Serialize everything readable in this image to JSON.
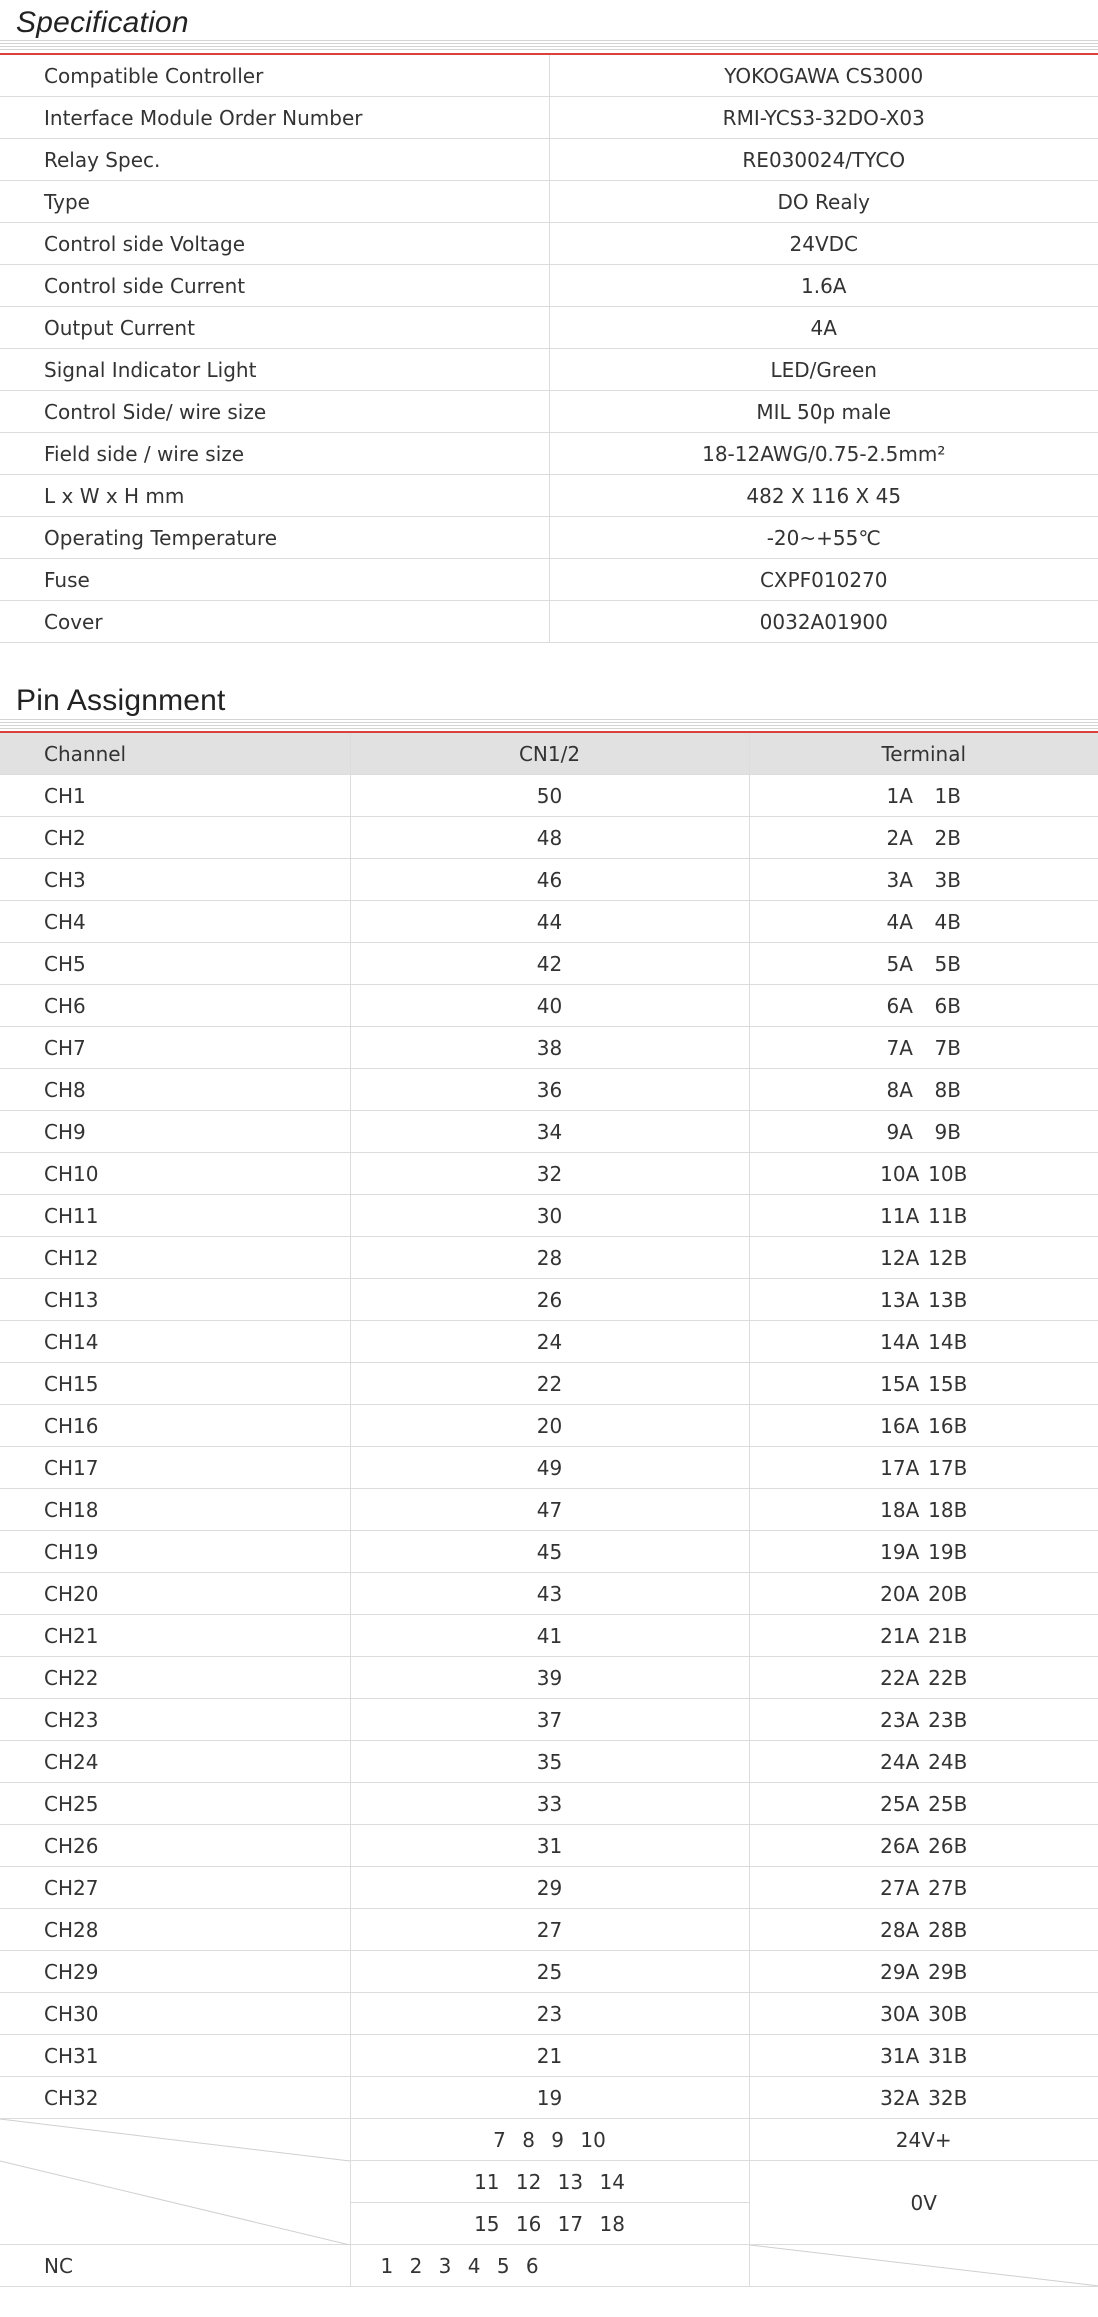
{
  "spec": {
    "title": "Specification",
    "rows": [
      {
        "label": "Compatible Controller",
        "value": "YOKOGAWA  CS3000"
      },
      {
        "label": "Interface Module Order Number",
        "value": "RMI-YCS3-32DO-X03"
      },
      {
        "label": "Relay Spec.",
        "value": "RE030024/TYCO"
      },
      {
        "label": "Type",
        "value": "DO Realy"
      },
      {
        "label": "Control side Voltage",
        "value": "24VDC"
      },
      {
        "label": "Control side Current",
        "value": "1.6A"
      },
      {
        "label": "Output Current",
        "value": "4A"
      },
      {
        "label": "Signal Indicator Light",
        "value": "LED/Green"
      },
      {
        "label": "Control Side/ wire size",
        "value": "MIL  50p  male"
      },
      {
        "label": "Field side / wire size",
        "value": "18-12AWG/0.75-2.5mm²"
      },
      {
        "label": "L x W x H mm",
        "value": "482 X 116 X 45"
      },
      {
        "label": "Operating Temperature",
        "value": "-20~+55℃"
      },
      {
        "label": "Fuse",
        "value": "CXPF010270"
      },
      {
        "label": "Cover",
        "value": "0032A01900"
      }
    ]
  },
  "pins": {
    "title": "Pin Assignment",
    "headers": [
      "Channel",
      "CN1/2",
      "Terminal"
    ],
    "rows": [
      {
        "ch": "CH1",
        "cn": "50",
        "a": "1A",
        "b": "1B"
      },
      {
        "ch": "CH2",
        "cn": "48",
        "a": "2A",
        "b": "2B"
      },
      {
        "ch": "CH3",
        "cn": "46",
        "a": "3A",
        "b": "3B"
      },
      {
        "ch": "CH4",
        "cn": "44",
        "a": "4A",
        "b": "4B"
      },
      {
        "ch": "CH5",
        "cn": "42",
        "a": "5A",
        "b": "5B"
      },
      {
        "ch": "CH6",
        "cn": "40",
        "a": "6A",
        "b": "6B"
      },
      {
        "ch": "CH7",
        "cn": "38",
        "a": "7A",
        "b": "7B"
      },
      {
        "ch": "CH8",
        "cn": "36",
        "a": "8A",
        "b": "8B"
      },
      {
        "ch": "CH9",
        "cn": "34",
        "a": "9A",
        "b": "9B"
      },
      {
        "ch": "CH10",
        "cn": "32",
        "a": "10A",
        "b": "10B"
      },
      {
        "ch": "CH11",
        "cn": "30",
        "a": "11A",
        "b": "11B"
      },
      {
        "ch": "CH12",
        "cn": "28",
        "a": "12A",
        "b": "12B"
      },
      {
        "ch": "CH13",
        "cn": "26",
        "a": "13A",
        "b": "13B"
      },
      {
        "ch": "CH14",
        "cn": "24",
        "a": "14A",
        "b": "14B"
      },
      {
        "ch": "CH15",
        "cn": "22",
        "a": "15A",
        "b": "15B"
      },
      {
        "ch": "CH16",
        "cn": "20",
        "a": "16A",
        "b": "16B"
      },
      {
        "ch": "CH17",
        "cn": "49",
        "a": "17A",
        "b": "17B"
      },
      {
        "ch": "CH18",
        "cn": "47",
        "a": "18A",
        "b": "18B"
      },
      {
        "ch": "CH19",
        "cn": "45",
        "a": "19A",
        "b": "19B"
      },
      {
        "ch": "CH20",
        "cn": "43",
        "a": "20A",
        "b": "20B"
      },
      {
        "ch": "CH21",
        "cn": "41",
        "a": "21A",
        "b": "21B"
      },
      {
        "ch": "CH22",
        "cn": "39",
        "a": "22A",
        "b": "22B"
      },
      {
        "ch": "CH23",
        "cn": "37",
        "a": "23A",
        "b": "23B"
      },
      {
        "ch": "CH24",
        "cn": "35",
        "a": "24A",
        "b": "24B"
      },
      {
        "ch": "CH25",
        "cn": "33",
        "a": "25A",
        "b": "25B"
      },
      {
        "ch": "CH26",
        "cn": "31",
        "a": "26A",
        "b": "26B"
      },
      {
        "ch": "CH27",
        "cn": "29",
        "a": "27A",
        "b": "27B"
      },
      {
        "ch": "CH28",
        "cn": "27",
        "a": "28A",
        "b": "28B"
      },
      {
        "ch": "CH29",
        "cn": "25",
        "a": "29A",
        "b": "29B"
      },
      {
        "ch": "CH30",
        "cn": "23",
        "a": "30A",
        "b": "30B"
      },
      {
        "ch": "CH31",
        "cn": "21",
        "a": "31A",
        "b": "31B"
      },
      {
        "ch": "CH32",
        "cn": "19",
        "a": "32A",
        "b": "32B"
      }
    ],
    "extra": {
      "pins_24v": "7   8   9   10",
      "label_24v": "24V+",
      "pins_0v_1": "11   12   13   14",
      "pins_0v_2": "15   16   17   18",
      "label_0v": "0V",
      "nc_label": "NC",
      "nc_pins": "1   2   3   4   5   6"
    }
  },
  "colors": {
    "accent_line": "#d9413a",
    "header_bg": "#e1e1e1",
    "grid": "#dcdcdc"
  }
}
